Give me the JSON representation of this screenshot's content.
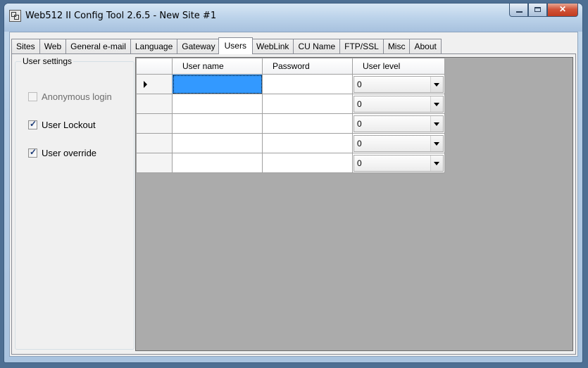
{
  "window": {
    "title": "Web512 II Config Tool 2.6.5 - New Site #1",
    "app_icon": "grid-app-icon"
  },
  "tabs": [
    {
      "label": "Sites"
    },
    {
      "label": "Web"
    },
    {
      "label": "General e-mail"
    },
    {
      "label": "Language"
    },
    {
      "label": "Gateway"
    },
    {
      "label": "Users",
      "active": true
    },
    {
      "label": "WebLink"
    },
    {
      "label": "CU Name"
    },
    {
      "label": "FTP/SSL"
    },
    {
      "label": "Misc"
    },
    {
      "label": "About"
    }
  ],
  "user_settings": {
    "title": "User settings",
    "anonymous_login": {
      "label": "Anonymous login",
      "checked": false,
      "enabled": false
    },
    "user_lockout": {
      "label": "User Lockout",
      "checked": true,
      "enabled": true
    },
    "user_override": {
      "label": "User override",
      "checked": true,
      "enabled": true
    }
  },
  "users_grid": {
    "columns": [
      "User name",
      "Password",
      "User level"
    ],
    "rows": [
      {
        "user_name": "",
        "password": "",
        "user_level": "0",
        "current": true
      },
      {
        "user_name": "",
        "password": "",
        "user_level": "0"
      },
      {
        "user_name": "",
        "password": "",
        "user_level": "0"
      },
      {
        "user_name": "",
        "password": "",
        "user_level": "0"
      },
      {
        "user_name": "",
        "password": "",
        "user_level": "0"
      }
    ]
  },
  "colors": {
    "selection": "#3399ff",
    "grid_background": "#ababab",
    "close_button": "#c23c1f"
  }
}
